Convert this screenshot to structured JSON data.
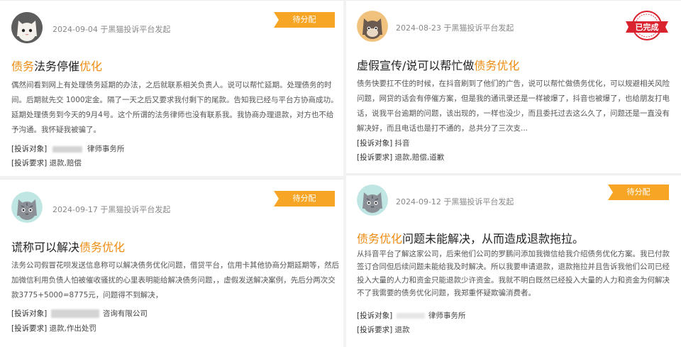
{
  "cards": [
    {
      "date": "2024-09-04 于黑猫投诉平台发起",
      "status": "待分配",
      "title_parts": [
        "债务",
        "法务停催",
        "优化"
      ],
      "body": "偶然间看到网上有处理债务延期的办法，之后就联系相关负责人。说可以帮忙延期。处理债务的时间。后期就先交 1000定金。隔了一天之后又要求我付剩下的尾款。告知我已经与平台方协商成功。延期处理债务到今天的9月4号。这个所谓的法务律师也没有联系我。我协商办理退款，对方也不给予沟通。我怀疑我被骗了。",
      "target_label": "[投诉对象]",
      "target_value": "律师事务所",
      "demand_label": "[投诉要求]",
      "demand_value": "退款,赔偿"
    },
    {
      "date": "2024-08-23 于黑猫投诉平台发起",
      "status": "已完成",
      "title_parts": [
        "虚假宣传/说可以帮忙做",
        "债务优化",
        ""
      ],
      "body": "债务快要扛不住的时候，在抖音刷到了他们的广告，说可以帮忙做债务优化，可以规避相关风险问题，网贷的话会有停催方案，但是我的通讯录还是一样被爆了，抖音也被爆了，也给朋友打电话，说我平台逾期的问题，该出现的，一样也没少，而且委托过去这么久了，问题还是一直没有解决好，而且电话也是打不通的，总共分了三次支...",
      "target_label": "[投诉对象]",
      "target_value": "抖音",
      "demand_label": "[投诉要求]",
      "demand_value": "退款,赔偿,道歉"
    },
    {
      "date": "2024-09-17 于黑猫投诉平台发起",
      "status": "待分配",
      "title_parts": [
        "谎称可以解决",
        "债务优化",
        ""
      ],
      "body": "法务公司假冒花呗发送信息称可以解决债务优化问题，借贷平台，信用卡其他协商分期延期等，然后加微信利用负债人怕被催收骚扰的心里表明能给解决债务问题，，虚假发送解决案例，先后分两次交款3775+5000=8775元，问题得不到解决，",
      "target_label": "[投诉对象]",
      "target_value": "咨询有限公司",
      "demand_label": "[投诉要求]",
      "demand_value": "退款,作出处罚"
    },
    {
      "date": "2024-09-12 于黑猫投诉平台发起",
      "status": "待分配",
      "title_parts": [
        "债务优化",
        "问题未能解决，从而造成退款拖拉。",
        ""
      ],
      "body": "从抖音平台了解这家公司，后来他们公司的罗鹏问添加我微信给我介绍债务优化方案。我已付款签订合同但后续问题未能给我及时解决。所以我要申请退款，退款拖拉并且告诉我他们公司已经投入大量的人力和资金只能退款少许资金。我就不明白既然已经投入大量的人力和资金为何解决不了我需要的债务优化问题，我郑重怀疑欺骗消费者。",
      "target_label": "[投诉对象]",
      "target_value": "律师事务所",
      "demand_label": "[投诉要求]",
      "demand_value": "退款"
    }
  ],
  "colors": {
    "accent": "#ee8c11",
    "tag": "#f7a524",
    "done_stamp": "#d9232e"
  },
  "icons": [
    "cat-avatar-white",
    "cat-avatar-orange",
    "cat-avatar-grey",
    "done-stamp-icon"
  ]
}
